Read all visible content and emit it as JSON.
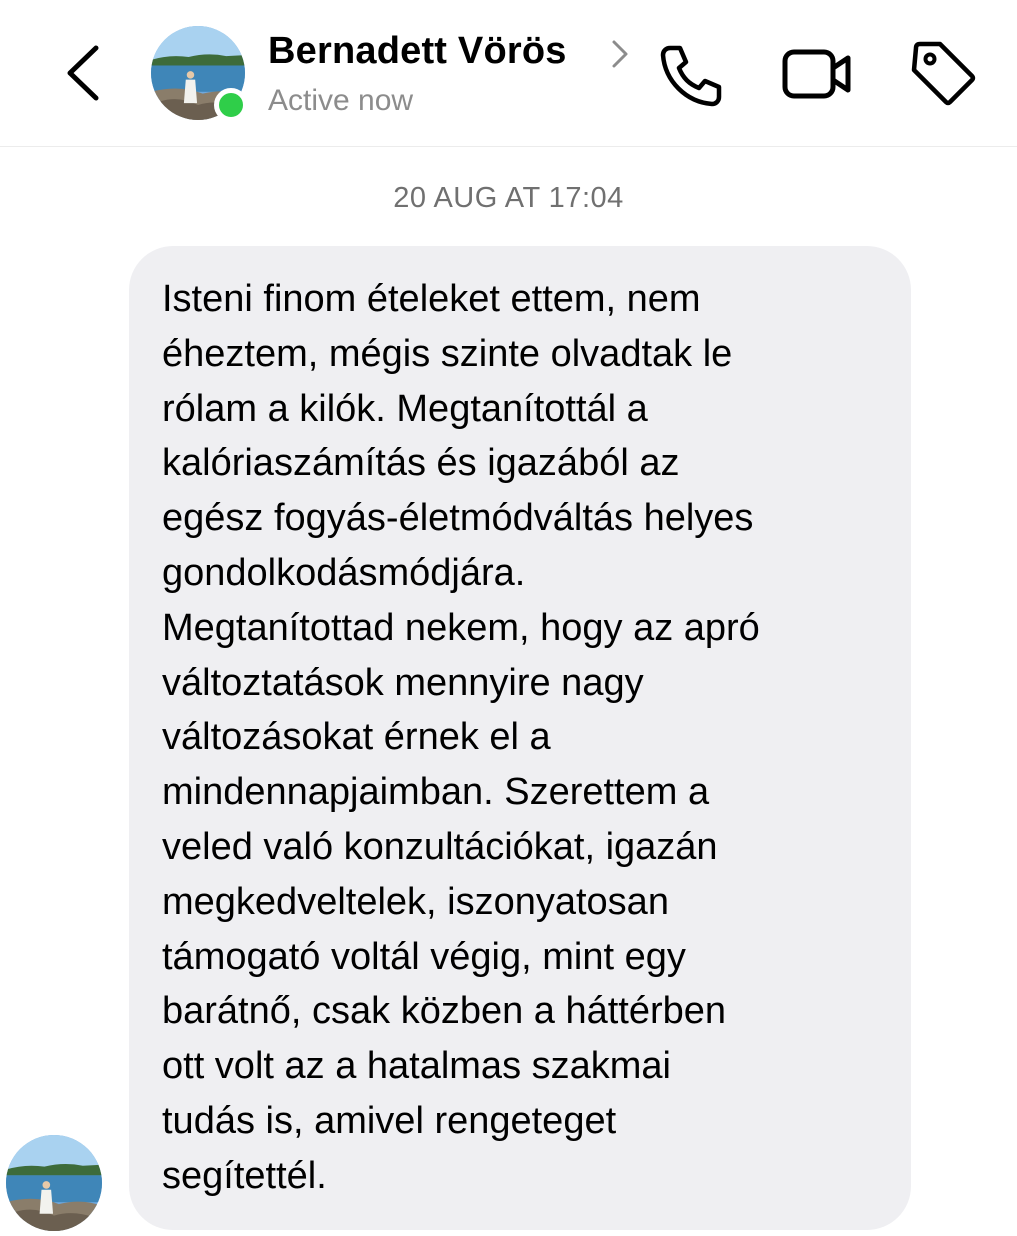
{
  "header": {
    "back_icon": "chevron-left-icon",
    "contact_name": "Bernadett Vörös",
    "name_chevron_icon": "chevron-right-icon",
    "presence": "Active now",
    "presence_color": "#2fce49",
    "actions": [
      {
        "icon": "phone-icon",
        "label": "Audio call"
      },
      {
        "icon": "video-camera-icon",
        "label": "Video call"
      },
      {
        "icon": "tag-icon",
        "label": "Label"
      }
    ]
  },
  "conversation": {
    "timestamp": "20 AUG AT 17:04",
    "messages": [
      {
        "from": "Bernadett Vörös",
        "text": "Isteni finom ételeket ettem, nem\néheztem, mégis szinte olvadtak le\nrólam a kilók. Megtanítottál a\nkalóriaszámítás és igazából az\negész fogyás-életmódváltás helyes\ngondolkodásmódjára.\nMegtanítottad nekem, hogy az apró\nváltoztatások mennyire nagy\nváltozásokat érnek el a\nmindennapjaimban. Szerettem a\nveled való konzultációkat, igazán\nmegkedveltelek, iszonyatosan\ntámogató voltál végig, mint egy\nbarátnő, csak közben a háttérben\nott volt az a hatalmas szakmai\ntudás is, amivel rengeteget\nsegítettél."
      }
    ]
  },
  "colors": {
    "bubble_background": "#efeff2",
    "timestamp_text": "#707070",
    "secondary_text": "#8c8c8c"
  }
}
